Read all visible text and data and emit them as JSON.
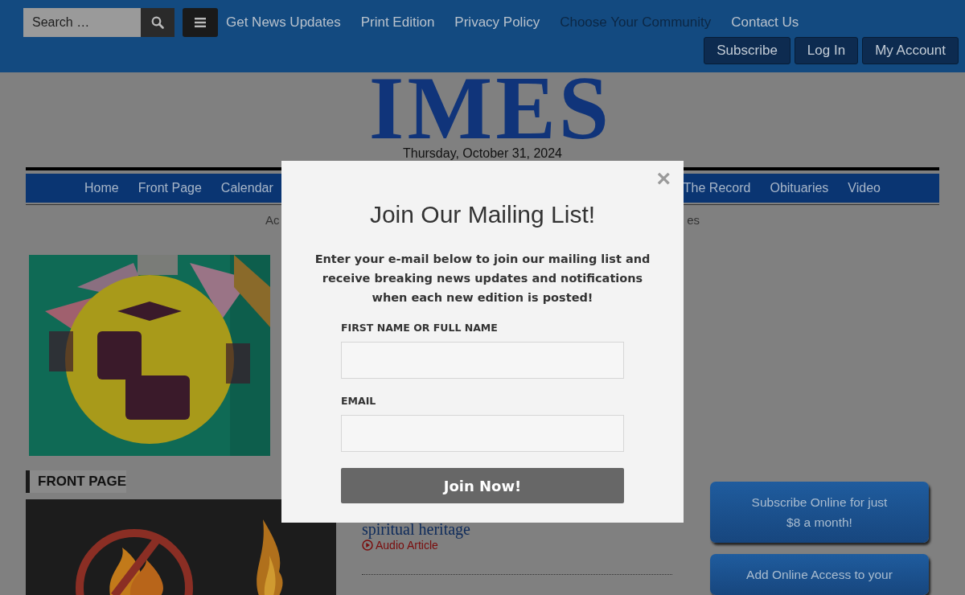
{
  "top_bar": {
    "search": {
      "placeholder": "Search …"
    },
    "links": [
      {
        "label": "Get News Updates",
        "highlighted": false
      },
      {
        "label": "Print Edition",
        "highlighted": false
      },
      {
        "label": "Privacy Policy",
        "highlighted": false
      },
      {
        "label": "Choose Your Community",
        "highlighted": true
      },
      {
        "label": "Contact Us",
        "highlighted": false
      }
    ],
    "account_buttons": [
      "Subscribe",
      "Log In",
      "My Account"
    ]
  },
  "masthead": {
    "logo": "IMES",
    "date": "Thursday, October 31, 2024"
  },
  "nav": {
    "items_left": [
      "Home",
      "Front Page",
      "Calendar"
    ],
    "items_right": [
      "The Record",
      "Obituaries",
      "Video"
    ]
  },
  "subnav": {
    "left": "Ac",
    "right": "es"
  },
  "left_column": {
    "section_heading": "FRONT PAGE"
  },
  "middle_column": {
    "headline": "spiritual heritage",
    "audio_link": "Audio Article"
  },
  "right_column": {
    "buttons": [
      {
        "lines": [
          "Subscribe Online for just",
          "$8 a month!"
        ]
      },
      {
        "lines": [
          "Add Online Access to your"
        ]
      }
    ]
  },
  "modal": {
    "close": "×",
    "title": "Join Our Mailing List!",
    "text": "Enter your e-mail below to join our mailing list and receive breaking news updates and notifications when each new edition is posted!",
    "fields": [
      {
        "label": "FIRST NAME OR FULL NAME"
      },
      {
        "label": "EMAIL"
      }
    ],
    "submit": "Join Now!"
  }
}
